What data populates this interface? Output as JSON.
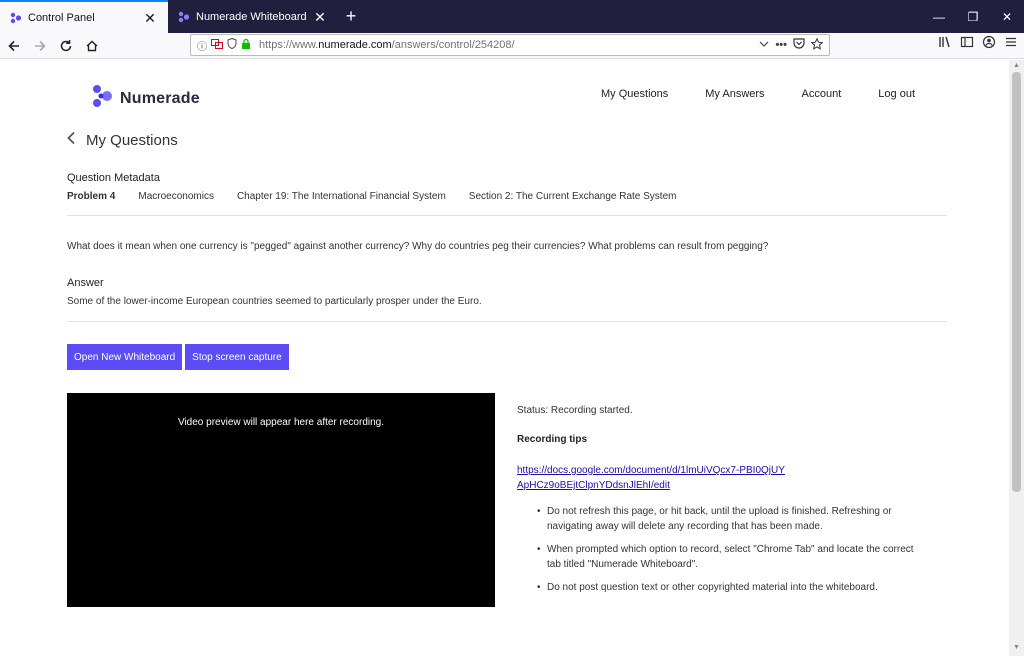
{
  "browser": {
    "tabs": [
      {
        "title": "Control Panel",
        "active": true
      },
      {
        "title": "Numerade Whiteboard",
        "active": false
      }
    ],
    "url_prefix": "https://www.",
    "url_host": "numerade.com",
    "url_path": "/answers/control/254208/"
  },
  "site": {
    "brand": "Numerade",
    "nav": [
      "My Questions",
      "My Answers",
      "Account",
      "Log out"
    ]
  },
  "page": {
    "back_title": "My Questions",
    "metadata_heading": "Question Metadata",
    "metadata": {
      "problem": "Problem 4",
      "subject": "Macroeconomics",
      "chapter": "Chapter 19: The International Financial System",
      "section": "Section 2: The Current Exchange Rate System"
    },
    "question": "What does it mean when one currency is \"pegged\" against another currency? Why do countries peg their currencies? What problems can result from pegging?",
    "answer_heading": "Answer",
    "answer": "Some of the lower-income European countries seemed to particularly prosper under the Euro.",
    "buttons": {
      "open_whiteboard": "Open New Whiteboard",
      "stop_capture": "Stop screen capture"
    },
    "video_placeholder": "Video preview will appear here after recording.",
    "status": "Status: Recording started.",
    "tips_heading": "Recording tips",
    "tips_link": "https://docs.google.com/document/d/1lmUiVQcx7-PBI0QjUYApHCz9oBEjtClpnYDdsnJlEhI/edit",
    "tips": [
      "Do not refresh this page, or hit back, until the upload is finished. Refreshing or navigating away will delete any recording that has been made.",
      "When prompted which option to record, select \"Chrome Tab\" and locate the correct tab titled \"Numerade Whiteboard\".",
      "Do not post question text or other copyrighted material into the whiteboard."
    ]
  },
  "colors": {
    "accent": "#5b4cf5",
    "tabbar": "#201f3d",
    "link": "#1a0dab"
  }
}
